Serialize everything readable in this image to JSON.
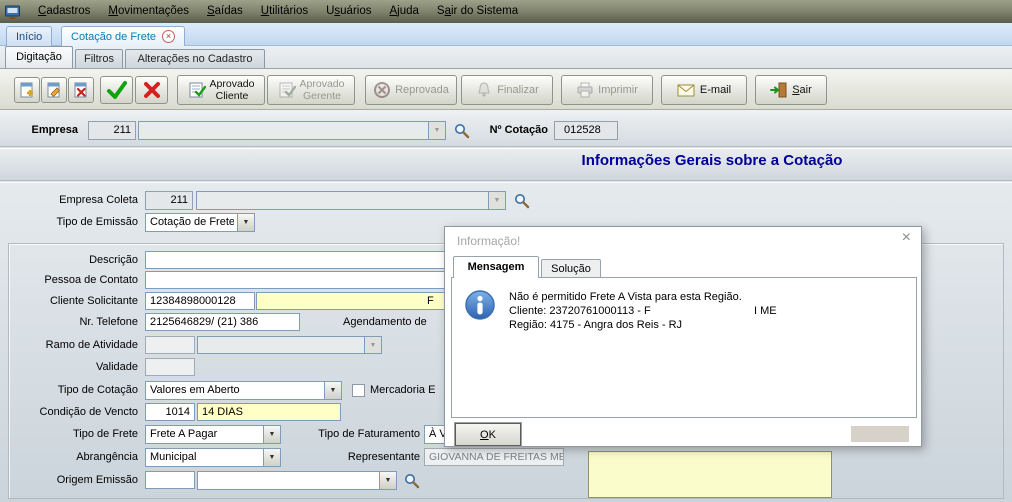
{
  "colors": {
    "section_title_blue": "#000099",
    "active_tab_teal": "#0A7AB8",
    "confirm_green": "#0FA30F",
    "cancel_red": "#D81E1E",
    "highlight_field_yellow": "#FFFFC6",
    "info_icon_blue": "#2B62AD",
    "menubar_olive": "#7C8069"
  },
  "menubar": {
    "items": [
      {
        "pre": "",
        "hot": "C",
        "rest": "adastros"
      },
      {
        "pre": "",
        "hot": "M",
        "rest": "ovimentações"
      },
      {
        "pre": "",
        "hot": "S",
        "rest": "aídas"
      },
      {
        "pre": "",
        "hot": "U",
        "rest": "tilitários"
      },
      {
        "pre": "U",
        "hot": "s",
        "rest": "uários"
      },
      {
        "pre": "",
        "hot": "A",
        "rest": "juda"
      },
      {
        "pre": "S",
        "hot": "a",
        "rest": "ir do Sistema"
      }
    ]
  },
  "main_tabs": {
    "inicio": "Início",
    "cotacao": "Cotação de Frete"
  },
  "sub_tabs": {
    "digitacao": "Digitação",
    "filtros": "Filtros",
    "alteracoes": "Alterações no Cadastro"
  },
  "toolbar": {
    "aprovado_cliente_line1": "Aprovado",
    "aprovado_cliente_line2": "Cliente",
    "aprovado_gerente_line1": "Aprovado",
    "aprovado_gerente_line2": "Gerente",
    "reprovada": "Reprovada",
    "finalizar": "Finalizar",
    "imprimir": "Imprimir",
    "email": "E-mail",
    "sair_hot": "S",
    "sair_rest": "air"
  },
  "header": {
    "empresa_label": "Empresa",
    "empresa_value": "211",
    "num_cotacao_label": "Nº Cotação",
    "num_cotacao_value": "012528",
    "section_title": "Informações Gerais sobre a Cotação"
  },
  "form": {
    "empresa_coleta_label": "Empresa Coleta",
    "empresa_coleta_value": "211",
    "tipo_emissao_label": "Tipo de Emissão",
    "tipo_emissao_value": "Cotação de Frete",
    "descricao_label": "Descrição",
    "descricao_value": "",
    "pessoa_contato_label": "Pessoa de Contato",
    "pessoa_contato_value": "",
    "cliente_solicitante_label": "Cliente Solicitante",
    "cliente_cnpj": "12384898000128",
    "cliente_nome_visivel": "F",
    "nr_telefone_label": "Nr. Telefone",
    "nr_telefone_value": "2125646829/ (21) 386",
    "agendamento_label": "Agendamento de",
    "ramo_atividade_label": "Ramo de Atividade",
    "ramo_atividade_value": "",
    "validade_label": "Validade",
    "validade_value": "",
    "tipo_cotacao_label": "Tipo de Cotação",
    "tipo_cotacao_value": "Valores em Aberto",
    "mercadoria_checkbox_label": "Mercadoria E",
    "condicao_vencto_label": "Condição de Vencto",
    "condicao_vencto_code": "1014",
    "condicao_vencto_desc": "14 DIAS",
    "tipo_frete_label": "Tipo de Frete",
    "tipo_frete_value": "Frete A Pagar",
    "tipo_faturamento_label": "Tipo de Faturamento",
    "tipo_faturamento_value": "À Vis",
    "abrangencia_label": "Abrangência",
    "abrangencia_value": "Municipal",
    "representante_label": "Representante",
    "representante_value": "GIOVANNA DE FREITAS MEN",
    "origem_emissao_label": "Origem Emissão",
    "origem_emissao_code": "",
    "origem_emissao_value": ""
  },
  "dialog": {
    "title": "Informação!",
    "tab_mensagem": "Mensagem",
    "tab_solucao": "Solução",
    "message_line1": "Não é permitido Frete A Vista para esta Região.",
    "message_line2": "Cliente: 23720761000113 - F",
    "message_line2_suffix": "I ME",
    "message_line3": "Região: 4175 - Angra dos Reis - RJ",
    "ok_hot": "O",
    "ok_rest": "K"
  }
}
